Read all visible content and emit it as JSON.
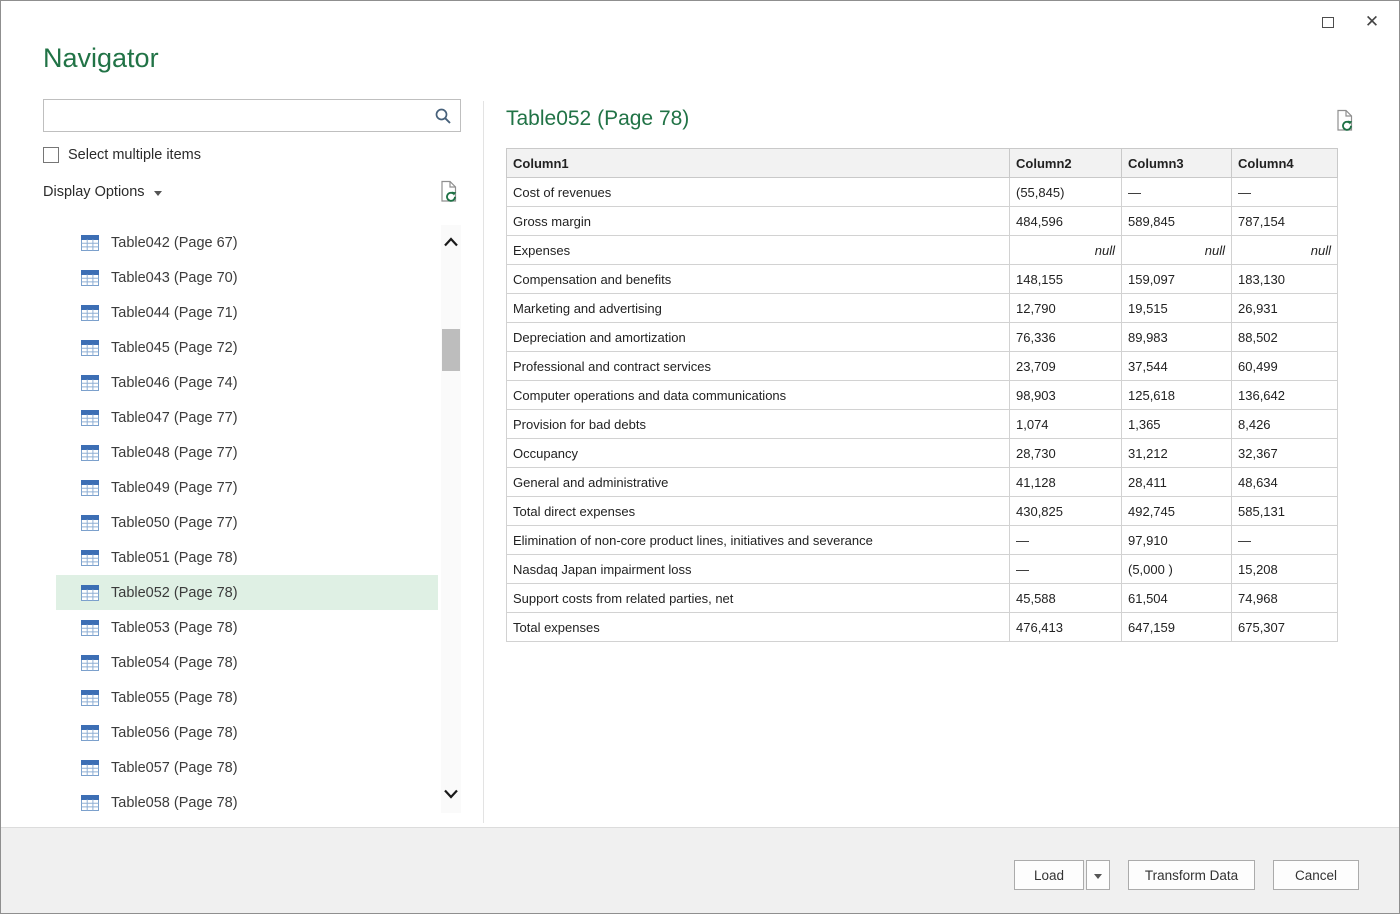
{
  "window": {
    "controls": {
      "maximize": "maximize",
      "close": "✕"
    }
  },
  "navigator": {
    "title": "Navigator",
    "search_placeholder": "",
    "select_multiple_label": "Select multiple items",
    "display_options_label": "Display Options",
    "items": [
      {
        "label": "Table042 (Page 67)",
        "selected": false
      },
      {
        "label": "Table043 (Page 70)",
        "selected": false
      },
      {
        "label": "Table044 (Page 71)",
        "selected": false
      },
      {
        "label": "Table045 (Page 72)",
        "selected": false
      },
      {
        "label": "Table046 (Page 74)",
        "selected": false
      },
      {
        "label": "Table047 (Page 77)",
        "selected": false
      },
      {
        "label": "Table048 (Page 77)",
        "selected": false
      },
      {
        "label": "Table049 (Page 77)",
        "selected": false
      },
      {
        "label": "Table050 (Page 77)",
        "selected": false
      },
      {
        "label": "Table051 (Page 78)",
        "selected": false
      },
      {
        "label": "Table052 (Page 78)",
        "selected": true
      },
      {
        "label": "Table053 (Page 78)",
        "selected": false
      },
      {
        "label": "Table054 (Page 78)",
        "selected": false
      },
      {
        "label": "Table055 (Page 78)",
        "selected": false
      },
      {
        "label": "Table056 (Page 78)",
        "selected": false
      },
      {
        "label": "Table057 (Page 78)",
        "selected": false
      },
      {
        "label": "Table058 (Page 78)",
        "selected": false
      }
    ]
  },
  "preview": {
    "title": "Table052 (Page 78)",
    "columns": [
      "Column1",
      "Column2",
      "Column3",
      "Column4"
    ],
    "rows": [
      [
        "Cost of revenues",
        "(55,845)",
        "—",
        "—"
      ],
      [
        "Gross margin",
        "484,596",
        "589,845",
        "787,154"
      ],
      [
        "Expenses",
        "null",
        "null",
        "null"
      ],
      [
        "Compensation and benefits",
        "148,155",
        "159,097",
        "183,130"
      ],
      [
        "Marketing and advertising",
        "12,790",
        "19,515",
        "26,931"
      ],
      [
        "Depreciation and amortization",
        "76,336",
        "89,983",
        "88,502"
      ],
      [
        "Professional and contract services",
        "23,709",
        "37,544",
        "60,499"
      ],
      [
        "Computer operations and data communications",
        "98,903",
        "125,618",
        "136,642"
      ],
      [
        "Provision for bad debts",
        "1,074",
        "1,365",
        "8,426"
      ],
      [
        "Occupancy",
        "28,730",
        "31,212",
        "32,367"
      ],
      [
        "General and administrative",
        "41,128",
        "28,411",
        "48,634"
      ],
      [
        "Total direct expenses",
        "430,825",
        "492,745",
        "585,131"
      ],
      [
        "Elimination of non-core product lines, initiatives and severance",
        "—",
        "97,910",
        "—"
      ],
      [
        "Nasdaq Japan impairment loss",
        "—",
        "(5,000 )",
        "15,208"
      ],
      [
        "Support costs from related parties, net",
        "45,588",
        "61,504",
        "74,968"
      ],
      [
        "Total expenses",
        "476,413",
        "647,159",
        "675,307"
      ]
    ]
  },
  "footer": {
    "load": "Load",
    "transform": "Transform Data",
    "cancel": "Cancel"
  },
  "colors": {
    "accent_green": "#217346",
    "selected_item_bg": "#DFF0E4"
  }
}
